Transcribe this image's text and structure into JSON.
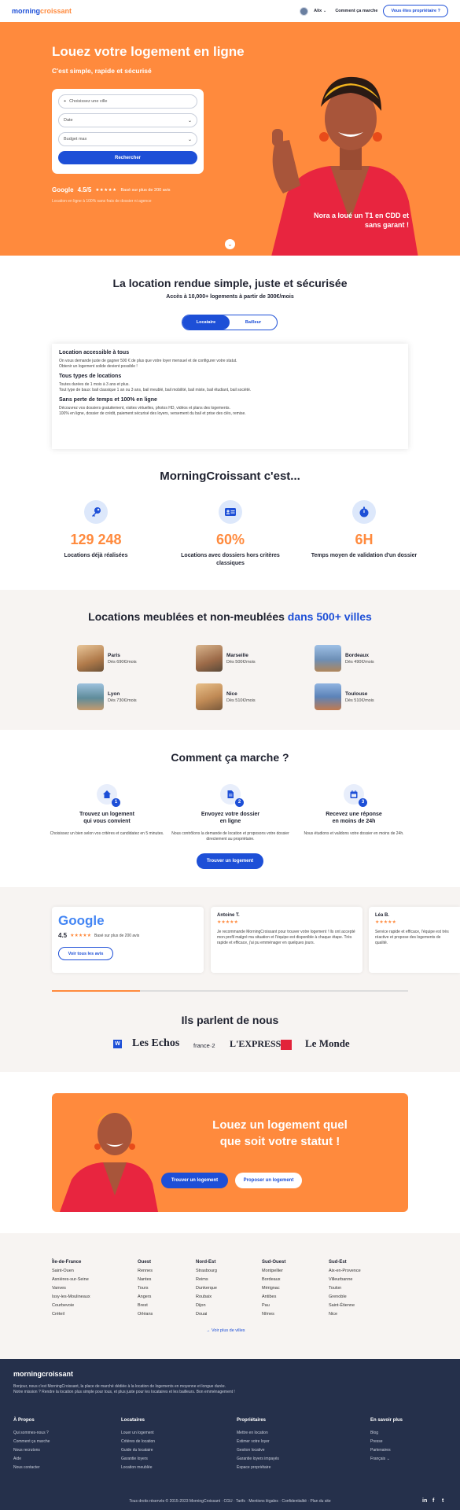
{
  "header": {
    "logo_main": "morning",
    "logo_accent": "croissant",
    "user_name": "Alix",
    "how_it_works": "Comment ça marche",
    "owner_button": "Vous êtes propriétaire ?"
  },
  "hero": {
    "title": "Louez votre logement en ligne",
    "subtitle": "C'est simple, rapide et sécurisé",
    "location_placeholder": "Choisissez une ville",
    "select_date": "Date",
    "select_budget": "Budget max",
    "search_button": "Rechercher",
    "rating_brand": "Google",
    "rating_score": "4.5/5",
    "rating_stars": "★★★★★",
    "rating_text": "Basé sur plus de 200 avis",
    "note": "Location en ligne à 100% sans frais de dossier ni agence",
    "quote": "Nora a loué un T1 en CDD et sans garant !"
  },
  "intro": {
    "title": "La location rendue simple, juste et sécurisée",
    "subtitle": "Accès à 10,000+ logements à partir de 300€/mois",
    "tab_tenant": "Locataire",
    "tab_owner": "Bailleur",
    "card": [
      {
        "heading": "Location accessible à tous",
        "lines": [
          "On vous demande juste de gagner 500 € de plus que votre loyer mensuel et de configurer votre statut.",
          "Obtenir un logement solide devient possible !"
        ]
      },
      {
        "heading": "Tous types de locations",
        "lines": [
          "Toutes durées de 1 mois à 3 ans et plus.",
          "Tout type de baux: bail classique 1 an ou 3 ans, bail meublé, bail mobilité, bail mixte, bail étudiant, bail société."
        ]
      },
      {
        "heading": "Sans perte de temps et 100% en ligne",
        "lines": [
          "Découvrez vos dossiers gratuitement, visites virtuelles, photos HD, vidéos et plans des logements.",
          "100% en ligne, dossier de crédit, paiement sécurisé des loyers, versement du bail et prise des clés, remise."
        ]
      }
    ]
  },
  "stats": {
    "title": "MorningCroissant c'est...",
    "items": [
      {
        "icon": "key-icon",
        "value": "129 248",
        "label": "Locations déjà réalisées"
      },
      {
        "icon": "id-card-icon",
        "value": "60%",
        "label": "Locations avec dossiers hors critères classiques"
      },
      {
        "icon": "stopwatch-icon",
        "value": "6H",
        "label": "Temps moyen de validation d'un dossier"
      }
    ]
  },
  "cities": {
    "title_main": "Locations meublées et non-meublées",
    "title_accent": "dans 500+ villes",
    "items": [
      {
        "name": "Paris",
        "price": "Dès 690€/mois",
        "color": "#b07a4a"
      },
      {
        "name": "Marseille",
        "price": "Dès 500€/mois",
        "color": "#9c6a48"
      },
      {
        "name": "Bordeaux",
        "price": "Dès 490€/mois",
        "color": "#6d8fb6"
      },
      {
        "name": "Lyon",
        "price": "Dès 730€/mois",
        "color": "#5f8c9a"
      },
      {
        "name": "Nice",
        "price": "Dès 510€/mois",
        "color": "#c08a55"
      },
      {
        "name": "Toulouse",
        "price": "Dès 510€/mois",
        "color": "#5c83b8"
      }
    ]
  },
  "how": {
    "title": "Comment ça marche ?",
    "steps": [
      {
        "num": "1",
        "icon": "home-icon",
        "title_1": "Trouvez un logement",
        "title_2": "qui vous convient",
        "desc": "Choisissez un bien selon vos critères et candidatez en 5 minutes."
      },
      {
        "num": "2",
        "icon": "document-icon",
        "title_1": "Envoyez votre dossier",
        "title_2": "en ligne",
        "desc": "Nous contrôlons la demande de location et proposons votre dossier directement au propriétaire."
      },
      {
        "num": "3",
        "icon": "calendar-icon",
        "title_1": "Recevez une réponse",
        "title_2": "en moins de 24h",
        "desc": "Nous étudions et validons votre dossier en moins de 24h."
      }
    ],
    "button": "Trouver un logement"
  },
  "reviews": {
    "google_logo": "Google",
    "score": "4.5",
    "stars": "★★★★★",
    "based_on": "Basé sur plus de 200 avis",
    "all_reviews_button": "Voir tous les avis",
    "items": [
      {
        "name": "Antoine T.",
        "stars": "★★★★★",
        "text": "Je recommande MorningCroissant pour trouver votre logement ! Ils ont accepté mon profil malgré ma situation et l'équipe est disponible à chaque étape. Très rapide et efficace, j'ai pu emménager en quelques jours."
      },
      {
        "name": "Léa B.",
        "stars": "★★★★★",
        "text": "Service rapide et efficace, l'équipe est très réactive et propose des logements de qualité."
      }
    ]
  },
  "press": {
    "title": "Ils parlent de nous",
    "logos": [
      "Les Echos",
      "france·2",
      "L'EXPRESS",
      "Le Monde"
    ]
  },
  "promo": {
    "title_1": "Louez un logement quel",
    "title_2": "que soit votre statut !",
    "button_find": "Trouver un logement",
    "button_offer": "Proposer un logement"
  },
  "footer_cities": {
    "columns": [
      {
        "head": "Île-de-France",
        "items": [
          "Saint-Ouen",
          "Asnières-sur-Seine",
          "Vanves",
          "Issy-les-Moulineaux",
          "Courbevoie",
          "Créteil"
        ]
      },
      {
        "head": "Ouest",
        "items": [
          "Rennes",
          "Nantes",
          "Tours",
          "Angers",
          "Brest",
          "Orléans"
        ]
      },
      {
        "head": "Nord-Est",
        "items": [
          "Strasbourg",
          "Reims",
          "Dunkerque",
          "Roubaix",
          "Dijon",
          "Douai"
        ]
      },
      {
        "head": "Sud-Ouest",
        "items": [
          "Montpellier",
          "Bordeaux",
          "Mérignac",
          "Antibes",
          "Pau",
          "Nîmes"
        ]
      },
      {
        "head": "Sud-Est",
        "items": [
          "Aix-en-Provence",
          "Villeurbanne",
          "Toulon",
          "Grenoble",
          "Saint-Étienne",
          "Nice"
        ]
      }
    ],
    "all_cities": "Voir plus de villes"
  },
  "dark_footer": {
    "logo": "morningcroissant",
    "intro_1": "Bonjour, nous c'est MorningCroissant, la place de marché dédiée à la location de logements en moyenne et longue durée.",
    "intro_2": "Notre mission ? Rendre la location plus simple pour tous, et plus juste pour les locataires et les bailleurs. Bon emménagement !",
    "columns": [
      {
        "head": "À Propos",
        "items": [
          "Qui sommes-nous ?",
          "Comment ça marche",
          "Nous recrutons",
          "Aide",
          "Nous contacter"
        ]
      },
      {
        "head": "Locataires",
        "items": [
          "Louer un logement",
          "Critères de location",
          "Guide du locataire",
          "Garantie loyers",
          "Location meublée"
        ]
      },
      {
        "head": "Propriétaires",
        "items": [
          "Mettre en location",
          "Estimer votre loyer",
          "Gestion locative",
          "Garantie loyers impayés",
          "Espace propriétaire"
        ]
      },
      {
        "head": "En savoir plus",
        "items": [
          "Blog",
          "Presse",
          "Partenaires",
          "Français"
        ]
      }
    ],
    "bottom": "Tous droits réservés © 2015-2023 MorningCroissant · CGU · Tarifs · Mentions légales · Confidentialité · Plan du site"
  }
}
